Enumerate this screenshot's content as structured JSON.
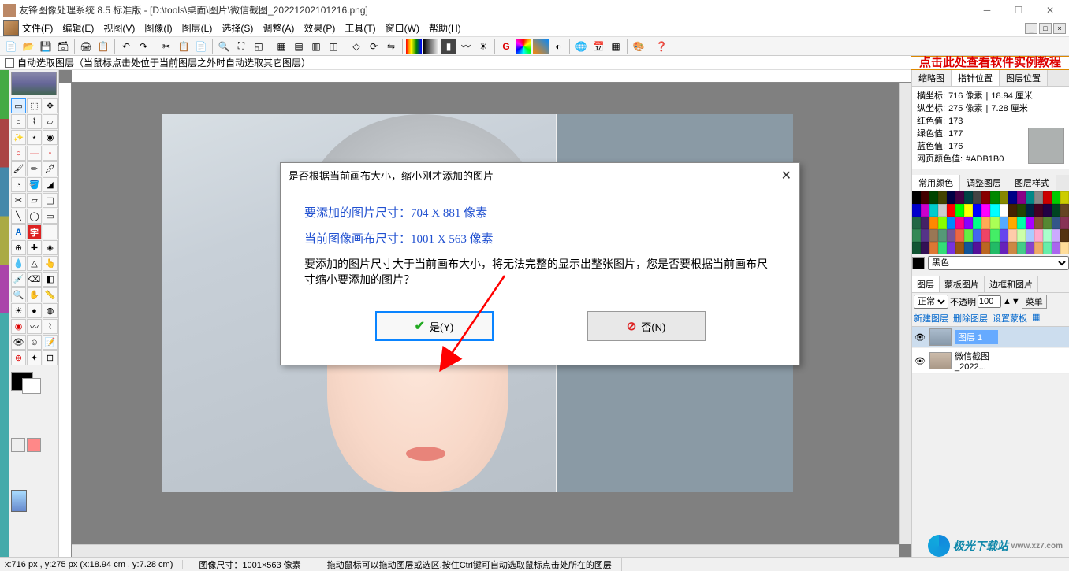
{
  "titlebar": {
    "text": "友锋图像处理系统 8.5 标准版 - [D:\\tools\\桌面\\图片\\微信截图_20221202101216.png]"
  },
  "menu": {
    "file": "文件(F)",
    "edit": "编辑(E)",
    "view": "视图(V)",
    "image": "图像(I)",
    "layer": "图层(L)",
    "select": "选择(S)",
    "adjust": "调整(A)",
    "effect": "效果(P)",
    "tool": "工具(T)",
    "window": "窗口(W)",
    "help": "帮助(H)"
  },
  "optionbar": {
    "autoSelect": "自动选取图层（当鼠标点击处位于当前图层之外时自动选取其它图层）",
    "tutorial": "点击此处查看软件实例教程"
  },
  "dialog": {
    "title": "是否根据当前画布大小，缩小刚才添加的图片",
    "line1": "要添加的图片尺寸：704 X 881 像素",
    "line2": "当前图像画布尺寸：1001 X 563 像素",
    "msg": "要添加的图片尺寸大于当前画布大小，将无法完整的显示出整张图片，您是否要根据当前画布尺寸缩小要添加的图片？",
    "yes": "是(Y)",
    "no": "否(N)"
  },
  "info": {
    "tab1": "缩略图",
    "tab2": "指针位置",
    "tab3": "图层位置",
    "xLabel": "横坐标:",
    "xVal": "716 像素",
    "xCm": "18.94 厘米",
    "yLabel": "纵坐标:",
    "yVal": "275 像素",
    "yCm": "7.28 厘米",
    "rLabel": "红色值:",
    "rVal": "173",
    "gLabel": "绿色值:",
    "gVal": "177",
    "bLabel": "蓝色值:",
    "bVal": "176",
    "hexLabel": "网页颜色值:",
    "hexVal": "#ADB1B0"
  },
  "palette": {
    "tab1": "常用颜色",
    "tab2": "调整图层",
    "tab3": "图层样式",
    "colorName": "黑色"
  },
  "layers": {
    "tab1": "图层",
    "tab2": "蒙板图片",
    "tab3": "边框和图片",
    "blend": "正常",
    "opacityLabel": "不透明",
    "opacity": "100",
    "menu": "菜单",
    "newLayer": "新建图层",
    "deleteLayer": "删除图层",
    "setMask": "设置蒙板",
    "item1": "图层 1",
    "item2a": "微信截图",
    "item2b": "_2022..."
  },
  "status": {
    "pos": "x:716 px , y:275 px (x:18.94 cm , y:7.28 cm)",
    "size": "图像尺寸：1001×563 像素",
    "tip": "拖动鼠标可以拖动图层或选区,按住Ctrl键可自动选取鼠标点击处所在的图层"
  },
  "watermark": "极光下载站"
}
